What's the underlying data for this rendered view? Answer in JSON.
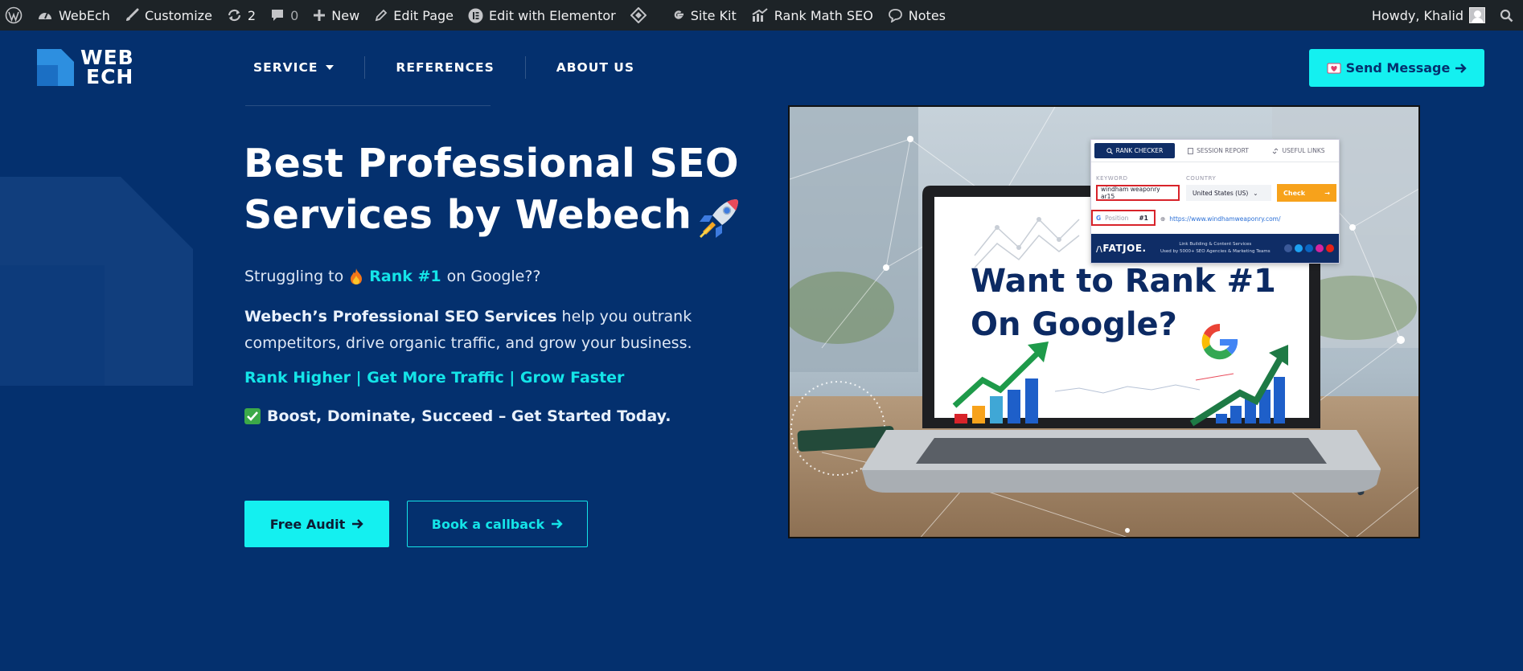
{
  "admin_bar": {
    "site_name": "WebEch",
    "customize": "Customize",
    "updates_count": "2",
    "comments_count": "0",
    "new": "New",
    "edit_page": "Edit Page",
    "edit_elementor": "Edit with Elementor",
    "site_kit": "Site Kit",
    "rank_math": "Rank Math SEO",
    "notes": "Notes",
    "howdy": "Howdy, Khalid"
  },
  "header": {
    "logo_line1": "WEB",
    "logo_line2": "ECH",
    "nav": [
      {
        "label": "SERVICE"
      },
      {
        "label": "REFERENCES"
      },
      {
        "label": "ABOUT US"
      }
    ],
    "send_message": "Send Message"
  },
  "hero": {
    "title_line1": "Best Professional SEO",
    "title_line2": "Services by Webech",
    "p1_before": "Struggling to",
    "p1_highlight": "Rank #1",
    "p1_after": "on Google??",
    "p2_bold": "Webech’s Professional SEO Services",
    "p2_rest": " help you outrank competitors, drive organic traffic, and grow your business.",
    "tagline": "Rank Higher | Get More Traffic | Grow Faster",
    "cta_text": "Boost, Dominate, Succeed – Get Started Today.",
    "btn_audit": "Free Audit",
    "btn_callback": "Book a callback"
  },
  "hero_image": {
    "line1": "Want to Rank #1",
    "line2": "On Google?",
    "widget": {
      "tab1": "RANK CHECKER",
      "tab2": "SESSION REPORT",
      "tab3": "USEFUL LINKS",
      "keyword_label": "KEYWORD",
      "country_label": "COUNTRY",
      "keyword_value": "windham weaponry ar15",
      "country_value": "United States (US)",
      "check": "Check",
      "position_label": "Position",
      "position_value": "#1",
      "url": "https://www.windhamweaponry.com/",
      "brand": "FATJOE.",
      "foot_line1": "Link Building & Content Services",
      "foot_line2": "Used by 5000+ SEO Agencies & Marketing Teams"
    }
  },
  "colors": {
    "page_bg": "#04306e",
    "accent": "#14f0f0",
    "admin_bar": "#1d2327"
  }
}
